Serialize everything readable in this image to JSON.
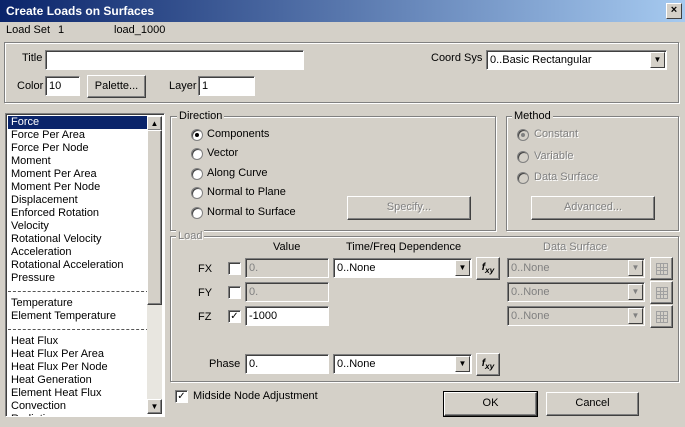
{
  "window": {
    "title": "Create Loads on Surfaces",
    "close_glyph": "×"
  },
  "header": {
    "loadset_label": "Load Set",
    "loadset_num": "1",
    "loadset_name": "load_1000"
  },
  "props": {
    "title_label": "Title",
    "title_value": "",
    "color_label": "Color",
    "color_value": "10",
    "palette_button": "Palette...",
    "layer_label": "Layer",
    "layer_value": "1",
    "coordsys_label": "Coord Sys",
    "coordsys_value": "0..Basic Rectangular"
  },
  "load_types": {
    "group1": [
      "Force",
      "Force Per Area",
      "Force Per Node",
      "Moment",
      "Moment Per Area",
      "Moment Per Node",
      "Displacement",
      "Enforced Rotation",
      "Velocity",
      "Rotational Velocity",
      "Acceleration",
      "Rotational Acceleration",
      "Pressure"
    ],
    "group2": [
      "Temperature",
      "Element Temperature"
    ],
    "group3": [
      "Heat Flux",
      "Heat Flux Per Area",
      "Heat Flux Per Node",
      "Heat Generation",
      "Element Heat Flux",
      "Convection",
      "Radiation"
    ],
    "selected": "Force"
  },
  "direction": {
    "title": "Direction",
    "options": [
      "Components",
      "Vector",
      "Along Curve",
      "Normal to Plane",
      "Normal to Surface"
    ],
    "selected": "Components",
    "specify_button": "Specify..."
  },
  "method": {
    "title": "Method",
    "options": [
      "Constant",
      "Variable",
      "Data Surface"
    ],
    "selected": "Constant",
    "advanced_button": "Advanced..."
  },
  "load": {
    "title": "Load",
    "col_value": "Value",
    "col_time": "Time/Freq Dependence",
    "col_datasurf": "Data Surface",
    "rows": [
      {
        "label": "FX",
        "checked": false,
        "value": "0.",
        "time": "0..None",
        "surface": "0..None"
      },
      {
        "label": "FY",
        "checked": false,
        "value": "0.",
        "time": "",
        "surface": "0..None"
      },
      {
        "label": "FZ",
        "checked": true,
        "value": "-1000",
        "time": "",
        "surface": "0..None"
      }
    ],
    "phase_label": "Phase",
    "phase_value": "0.",
    "phase_time": "0..None",
    "fxy_label": "f",
    "fxy_sub": "xy"
  },
  "footer": {
    "midside_label": "Midside Node Adjustment",
    "midside_checked": true,
    "ok": "OK",
    "cancel": "Cancel"
  },
  "icons": {
    "check": "✓",
    "arrow_down": "▼",
    "arrow_up": "▲"
  }
}
